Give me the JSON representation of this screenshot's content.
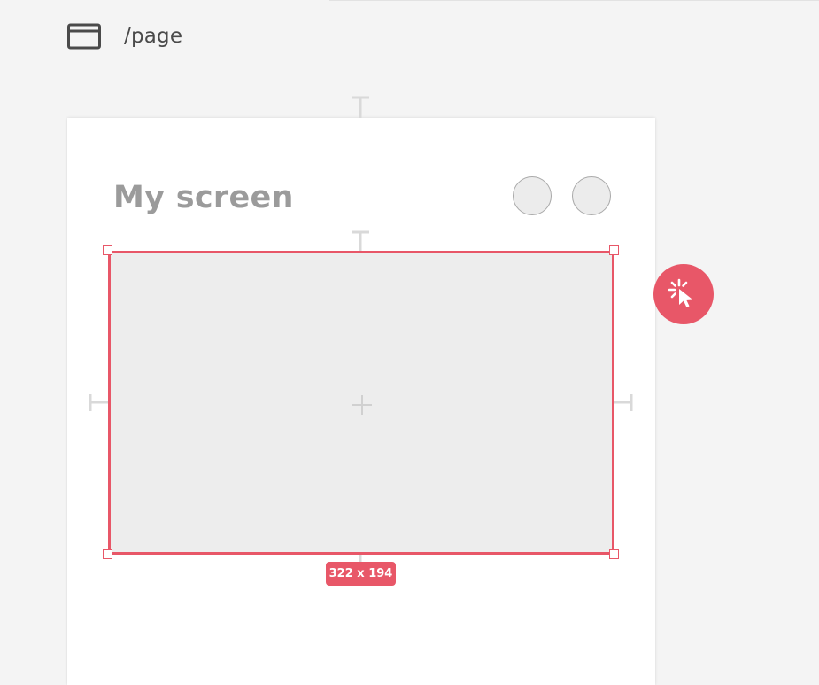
{
  "page": {
    "path": "/page",
    "icon": "browser-window-icon"
  },
  "screen": {
    "title": "My screen",
    "header_circles": [
      "circle-placeholder",
      "circle-placeholder"
    ]
  },
  "selection": {
    "size_label": "322 x 194",
    "accent_color": "#e85768"
  },
  "tools": {
    "cursor_button_icon": "click-cursor-icon"
  },
  "colors": {
    "background": "#f4f4f4",
    "canvas": "#ffffff",
    "placeholder_fill": "#ededed",
    "title_text": "#9b9b9b",
    "guide": "#d7d7d7"
  }
}
